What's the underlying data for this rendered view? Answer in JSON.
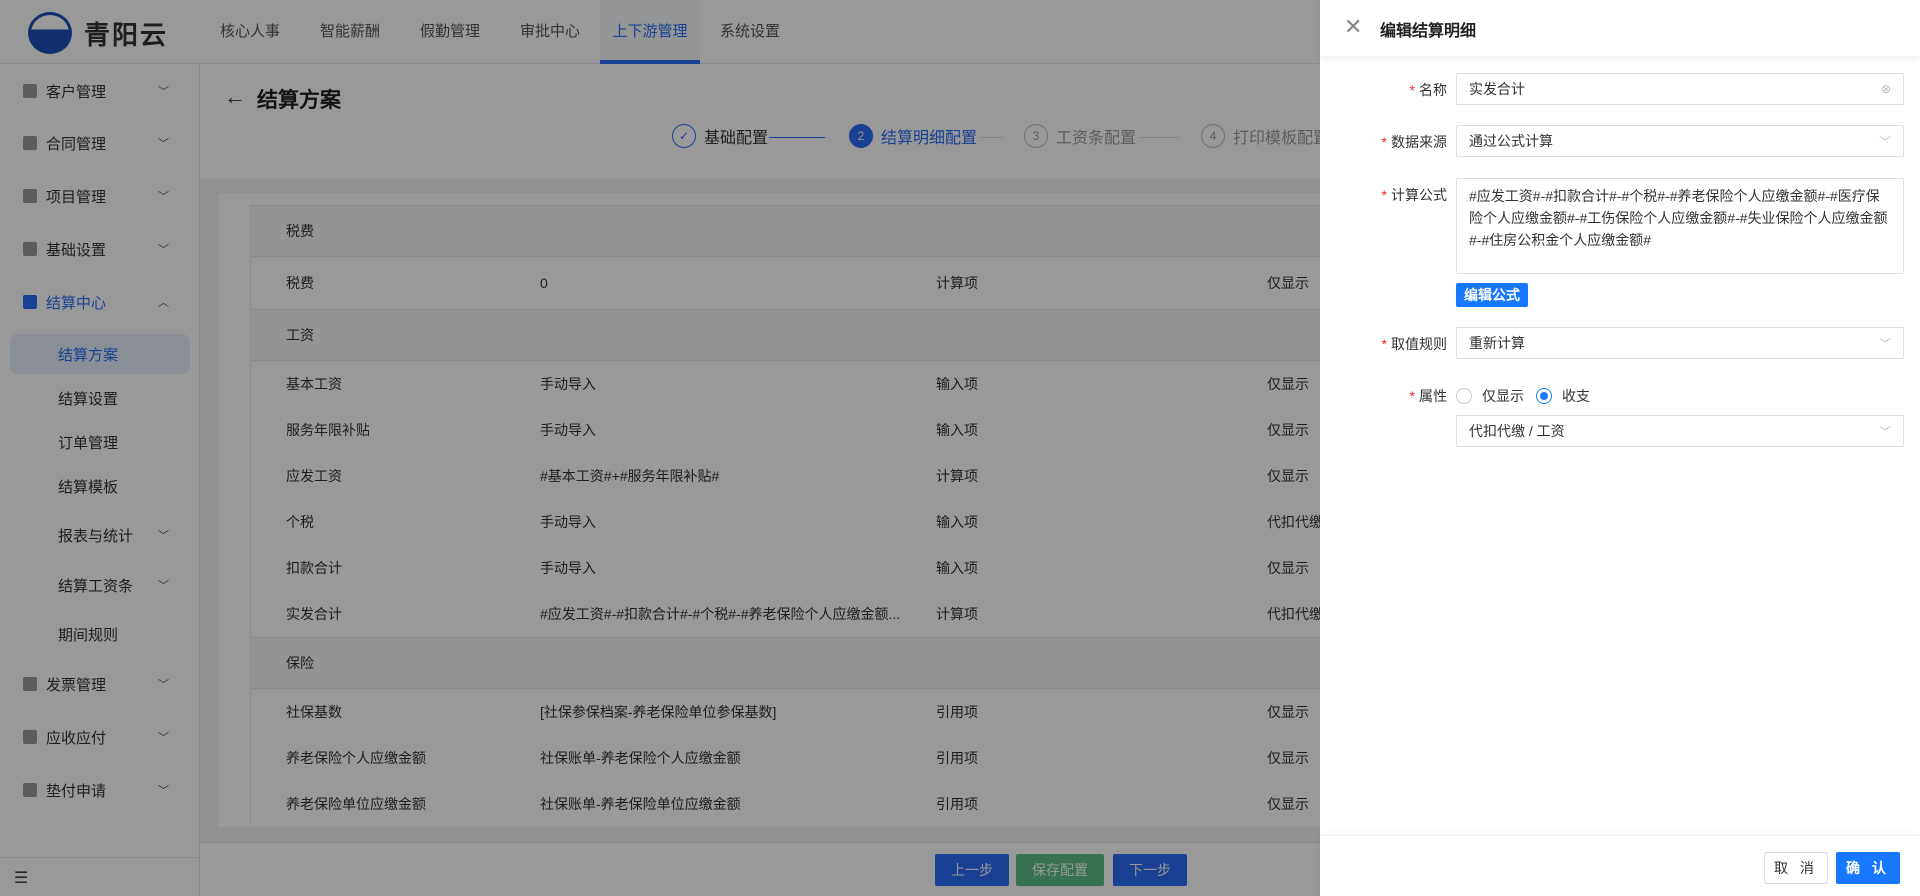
{
  "app": {
    "name": "青阳云"
  },
  "nav": [
    {
      "label": "核心人事"
    },
    {
      "label": "智能薪酬"
    },
    {
      "label": "假勤管理"
    },
    {
      "label": "审批中心"
    },
    {
      "label": "上下游管理",
      "active": true
    },
    {
      "label": "系统设置"
    }
  ],
  "sidebar": {
    "items": [
      {
        "label": "客户管理",
        "chevron": "down"
      },
      {
        "label": "合同管理",
        "chevron": "down"
      },
      {
        "label": "项目管理",
        "chevron": "down"
      },
      {
        "label": "基础设置",
        "chevron": "down"
      },
      {
        "label": "结算中心",
        "chevron": "up",
        "open": true
      },
      {
        "label": "结算方案",
        "sub": true,
        "selected": true
      },
      {
        "label": "结算设置",
        "sub": true
      },
      {
        "label": "订单管理",
        "sub": true
      },
      {
        "label": "结算模板",
        "sub": true
      },
      {
        "label": "报表与统计",
        "sub": true,
        "chevron": "down"
      },
      {
        "label": "结算工资条",
        "sub": true,
        "chevron": "down"
      },
      {
        "label": "期间规则",
        "sub": true
      },
      {
        "label": "发票管理",
        "chevron": "down"
      },
      {
        "label": "应收应付",
        "chevron": "down"
      },
      {
        "label": "垫付申请",
        "chevron": "down"
      }
    ]
  },
  "page": {
    "title": "结算方案"
  },
  "steps": [
    {
      "num": "✓",
      "label": "基础配置",
      "state": "done"
    },
    {
      "num": "2",
      "label": "结算明细配置",
      "state": "current"
    },
    {
      "num": "3",
      "label": "工资条配置",
      "state": "todo"
    },
    {
      "num": "4",
      "label": "打印模板配置",
      "state": "todo"
    }
  ],
  "table": {
    "rows": [
      {
        "group": "税费"
      },
      {
        "cells": [
          "税费",
          "0",
          "计算项",
          "仅显示"
        ]
      },
      {
        "group": "工资"
      },
      {
        "cells": [
          "基本工资",
          "手动导入",
          "输入项",
          "仅显示"
        ]
      },
      {
        "cells": [
          "服务年限补贴",
          "手动导入",
          "输入项",
          "仅显示"
        ]
      },
      {
        "cells": [
          "应发工资",
          "#基本工资#+#服务年限补贴#",
          "计算项",
          "仅显示"
        ]
      },
      {
        "cells": [
          "个税",
          "手动导入",
          "输入项",
          "代扣代缴"
        ]
      },
      {
        "cells": [
          "扣款合计",
          "手动导入",
          "输入项",
          "仅显示"
        ]
      },
      {
        "cells": [
          "实发合计",
          "#应发工资#-#扣款合计#-#个税#-#养老保险个人应缴金额...",
          "计算项",
          "代扣代缴"
        ]
      },
      {
        "group": "保险"
      },
      {
        "cells": [
          "社保基数",
          "[社保参保档案-养老保险单位参保基数]",
          "引用项",
          "仅显示"
        ]
      },
      {
        "cells": [
          "养老保险个人应缴金额",
          "社保账单-养老保险个人应缴金额",
          "引用项",
          "仅显示"
        ]
      },
      {
        "cells": [
          "养老保险单位应缴金额",
          "社保账单-养老保险单位应缴金额",
          "引用项",
          "仅显示"
        ]
      }
    ]
  },
  "footer": {
    "prev": "上一步",
    "save": "保存配置",
    "next": "下一步"
  },
  "drawer": {
    "title": "编辑结算明细",
    "name": {
      "label": "名称",
      "value": "实发合计"
    },
    "source": {
      "label": "数据来源",
      "value": "通过公式计算"
    },
    "formula": {
      "label": "计算公式",
      "value": "#应发工资#-#扣款合计#-#个税#-#养老保险个人应缴金额#-#医疗保险个人应缴金额#-#工伤保险个人应缴金额#-#失业保险个人应缴金额#-#住房公积金个人应缴金额#",
      "edit_button": "编辑公式"
    },
    "rule": {
      "label": "取值规则",
      "value": "重新计算"
    },
    "attr": {
      "label": "属性",
      "options": [
        "仅显示",
        "收支"
      ],
      "selected": "收支",
      "category": "代扣代缴 / 工资"
    },
    "cancel": "取 消",
    "confirm": "确 认"
  },
  "colors": {
    "primary": "#2b6bf5",
    "drawer_primary": "#1677ff",
    "save_green": "#5ebd88",
    "required": "#f5222d"
  }
}
